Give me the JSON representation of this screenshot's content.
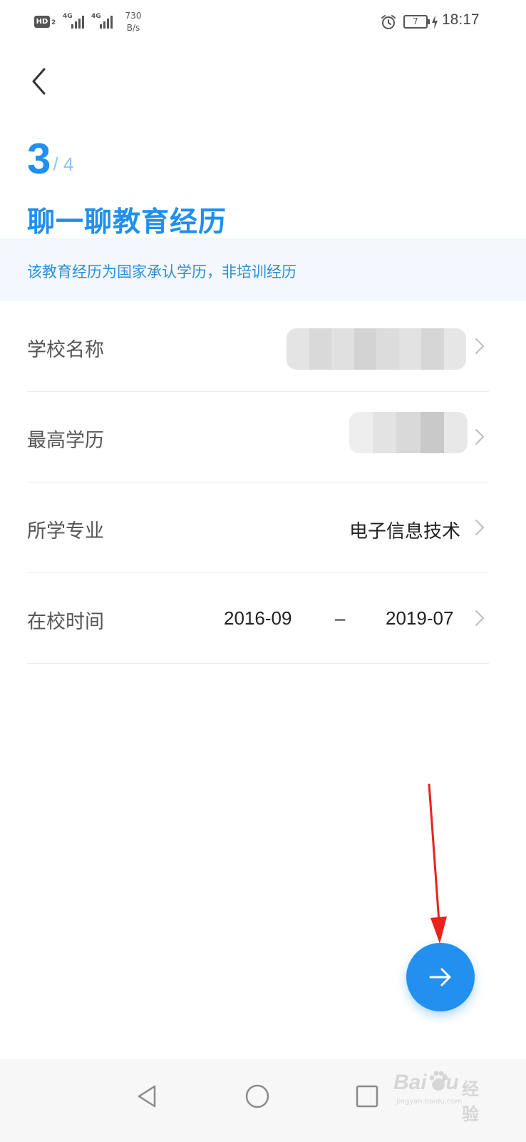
{
  "status_bar": {
    "hd_label": "HD",
    "hd_sub": "2",
    "sim1_label": "4G",
    "sim2_label": "4G",
    "speed_value": "730",
    "speed_unit": "B/s",
    "battery": "7",
    "time": "18:17"
  },
  "step": {
    "current": "3",
    "total": "/ 4"
  },
  "title": "聊一聊教育经历",
  "notice": "该教育经历为国家承认学历，非培训经历",
  "rows": {
    "school": {
      "label": "学校名称"
    },
    "degree": {
      "label": "最高学历"
    },
    "major": {
      "label": "所学专业",
      "value": "电子信息技术"
    },
    "period": {
      "label": "在校时间",
      "start": "2016-09",
      "separator": "–",
      "end": "2019-07"
    }
  },
  "icons": {
    "back": "chevron-left-icon",
    "row_arrow": "chevron-right-icon",
    "next": "arrow-right-icon",
    "nav_back": "triangle-back-icon",
    "nav_home": "circle-home-icon",
    "nav_recent": "square-recent-icon"
  },
  "colors": {
    "primary": "#1f8ff0",
    "notice_bg": "#f2f8fd",
    "annotation": "#e8231b"
  },
  "watermark": {
    "brand": "Bai  du",
    "suffix": "经验",
    "url": "jingyan.baidu.com"
  }
}
